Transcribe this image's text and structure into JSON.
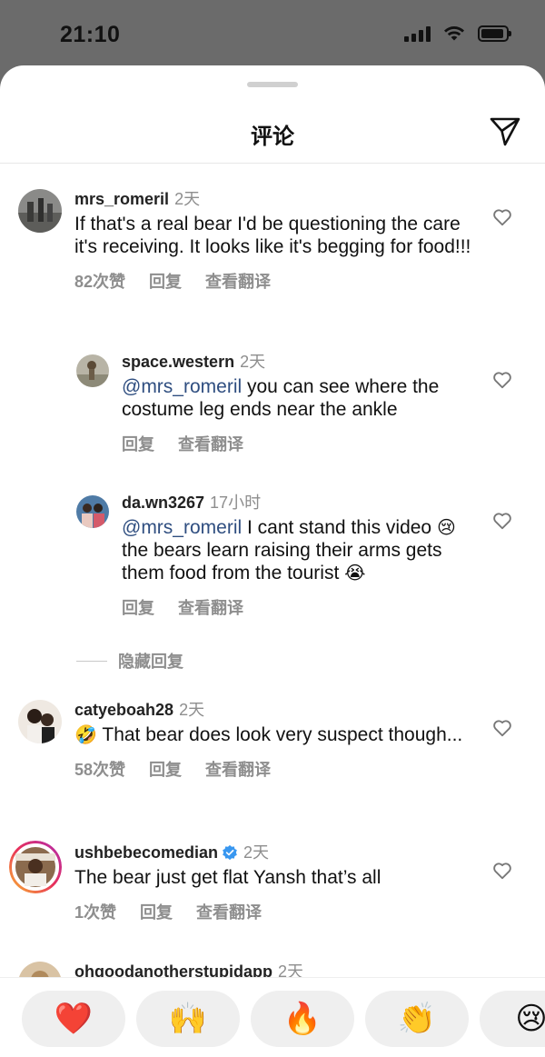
{
  "status": {
    "time": "21:10"
  },
  "header": {
    "title": "评论"
  },
  "comments": [
    {
      "username": "mrs_romeril",
      "time": "2天",
      "text": "If that's a real bear I'd be questioning the care it's receiving. It looks like it's begging for food!!!",
      "likes": "82次赞",
      "reply": "回复",
      "translate": "查看翻译"
    },
    {
      "username": "space.western",
      "time": "2天",
      "mention": "@mrs_romeril",
      "text": " you can see where the costume leg ends near the ankle",
      "reply": "回复",
      "translate": "查看翻译"
    },
    {
      "username": "da.wn3267",
      "time": "17小时",
      "mention": "@mrs_romeril",
      "text_a": " I cant stand this video ",
      "emoji_a": "😢",
      "text_b": " the bears learn raising their arms gets them food from the tourist ",
      "emoji_b": "😭",
      "reply": "回复",
      "translate": "查看翻译"
    },
    {
      "username": "catyeboah28",
      "time": "2天",
      "emoji": "🤣",
      "text": " That bear does look very suspect though...",
      "likes": "58次赞",
      "reply": "回复",
      "translate": "查看翻译"
    },
    {
      "username": "ushbebecomedian",
      "time": "2天",
      "text": "The bear just get flat Yansh that’s all",
      "likes": "1次赞",
      "reply": "回复",
      "translate": "查看翻译"
    },
    {
      "username": "ohgoodanotherstupidapp",
      "time": "2天"
    }
  ],
  "hide_replies": "隐藏回复",
  "reactions": [
    "❤️",
    "🙌",
    "🔥",
    "👏",
    "😢"
  ],
  "colors": {
    "mention": "#2f4e80",
    "muted": "#8e8e8e",
    "verified": "#3897f0"
  }
}
